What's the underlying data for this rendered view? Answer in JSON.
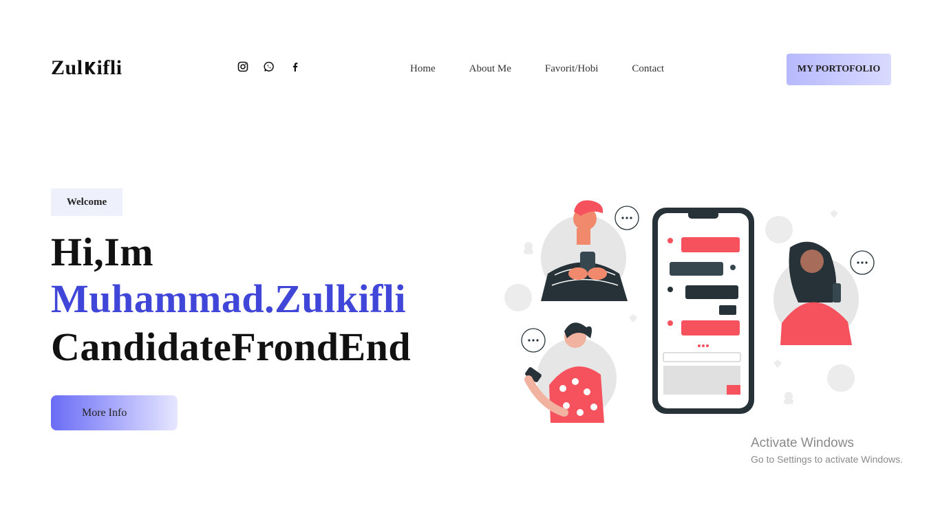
{
  "header": {
    "logo_prefix": "Zul",
    "logo_suffix": "ifli",
    "social_icons": [
      "instagram-icon",
      "whatsapp-icon",
      "facebook-icon"
    ],
    "nav": [
      "Home",
      "About Me",
      "Favorit/Hobi",
      "Contact"
    ],
    "portfolio_label": "MY PORTOFOLIO"
  },
  "hero": {
    "badge": "Welcome",
    "line1": "Hi,Im",
    "line2": "Muhammad.Zulkifli",
    "line3": "CandidateFrondEnd",
    "button_label": "More Info"
  },
  "illustration": {
    "icon": "chat-app-illustration"
  },
  "colors": {
    "accent": "#3f46d8",
    "button_gradient_start": "#6a6cf5",
    "chat_red": "#f6525e",
    "phone_dark": "#263238"
  },
  "watermark": {
    "title": "Activate Windows",
    "subtitle": "Go to Settings to activate Windows."
  }
}
